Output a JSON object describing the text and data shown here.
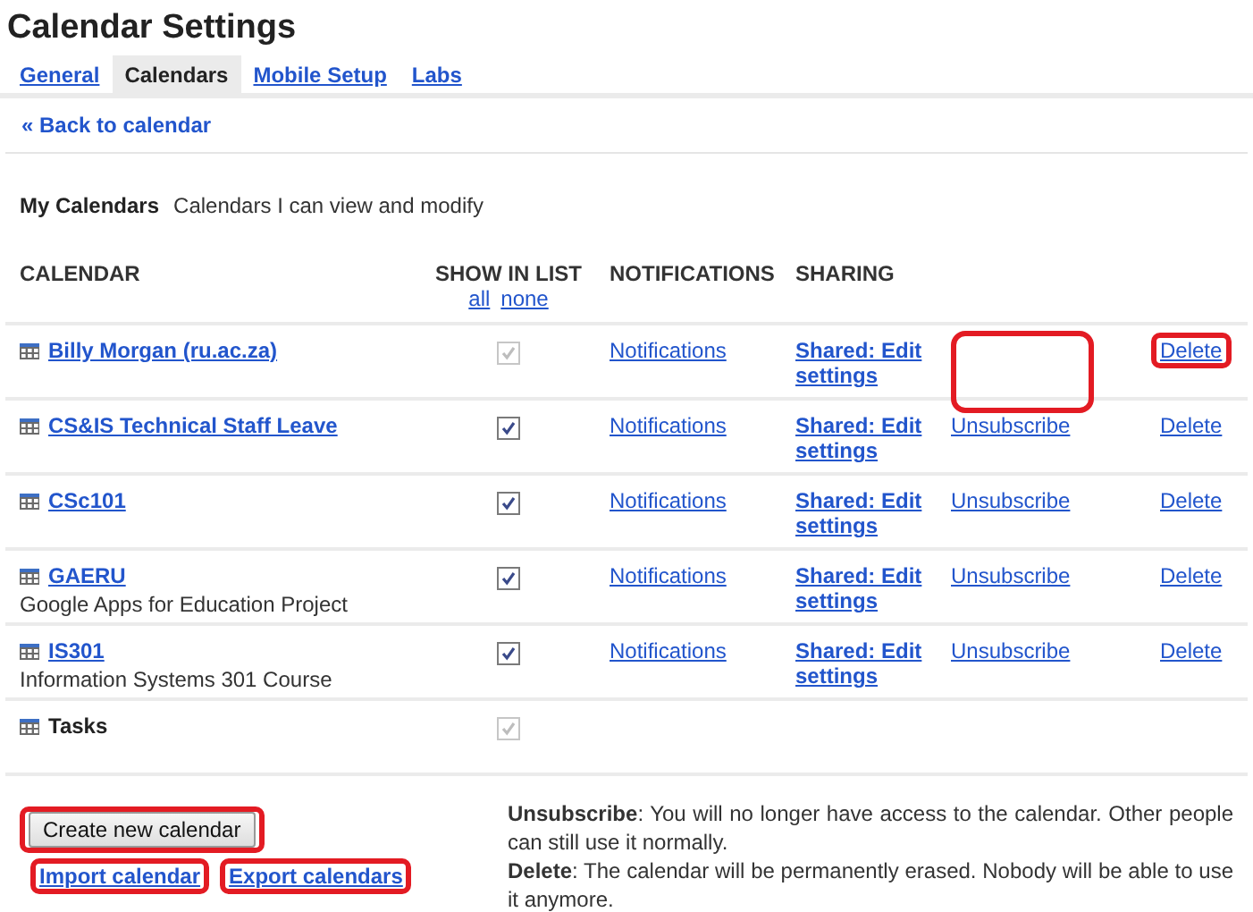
{
  "title": "Calendar Settings",
  "tabs": [
    {
      "label": "General",
      "selected": false
    },
    {
      "label": "Calendars",
      "selected": true
    },
    {
      "label": "Mobile Setup",
      "selected": false
    },
    {
      "label": "Labs",
      "selected": false
    }
  ],
  "back_link": "« Back to calendar",
  "section": {
    "title": "My Calendars",
    "subtitle": "Calendars I can view and modify"
  },
  "table": {
    "columns": [
      "CALENDAR",
      "SHOW IN LIST",
      "NOTIFICATIONS",
      "SHARING"
    ],
    "show_links": [
      "all",
      "none"
    ],
    "rows": [
      {
        "kind": "calendar",
        "name": "Billy Morgan (ru.ac.za)",
        "checked": true,
        "disabled": true,
        "notifications": "Notifications",
        "sharing": "Shared: Edit settings",
        "unsubscribe_highlighted": true,
        "delete": "Delete",
        "delete_highlighted": true
      },
      {
        "kind": "calendar",
        "name": "CS&IS Technical Staff Leave",
        "checked": true,
        "disabled": false,
        "notifications": "Notifications",
        "sharing": "Shared: Edit settings",
        "unsubscribe": "Unsubscribe",
        "unsubscribe_highlighted": false,
        "delete": "Delete",
        "delete_highlighted": false
      },
      {
        "kind": "calendar",
        "name": "CSc101",
        "checked": true,
        "disabled": false,
        "notifications": "Notifications",
        "sharing": "Shared: Edit settings",
        "unsubscribe": "Unsubscribe",
        "unsubscribe_highlighted": false,
        "delete": "Delete",
        "delete_highlighted": false
      },
      {
        "kind": "calendar",
        "name": "GAERU",
        "description": "Google Apps for Education Project",
        "checked": true,
        "disabled": false,
        "notifications": "Notifications",
        "sharing": "Shared: Edit settings",
        "unsubscribe": "Unsubscribe",
        "unsubscribe_highlighted": false,
        "delete": "Delete",
        "delete_highlighted": false
      },
      {
        "kind": "calendar",
        "name": "IS301",
        "description": "Information Systems 301 Course",
        "checked": true,
        "disabled": false,
        "notifications": "Notifications",
        "sharing": "Shared: Edit settings",
        "unsubscribe": "Unsubscribe",
        "unsubscribe_highlighted": false,
        "delete": "Delete",
        "delete_highlighted": false
      },
      {
        "kind": "tasks",
        "name": "Tasks",
        "checked": true,
        "disabled": true
      }
    ]
  },
  "create_button": {
    "label": "Create new calendar",
    "highlighted": true
  },
  "footer_links": [
    {
      "label": "Import calendar",
      "highlighted": true
    },
    {
      "label": "Export calendars",
      "highlighted": true
    }
  ],
  "notes": [
    "**Unsubscribe**: You will no longer have access to the calendar. Other people can still use it normally.",
    "**Delete**: The calendar will be permanently erased. Nobody will be able to use it anymore."
  ]
}
